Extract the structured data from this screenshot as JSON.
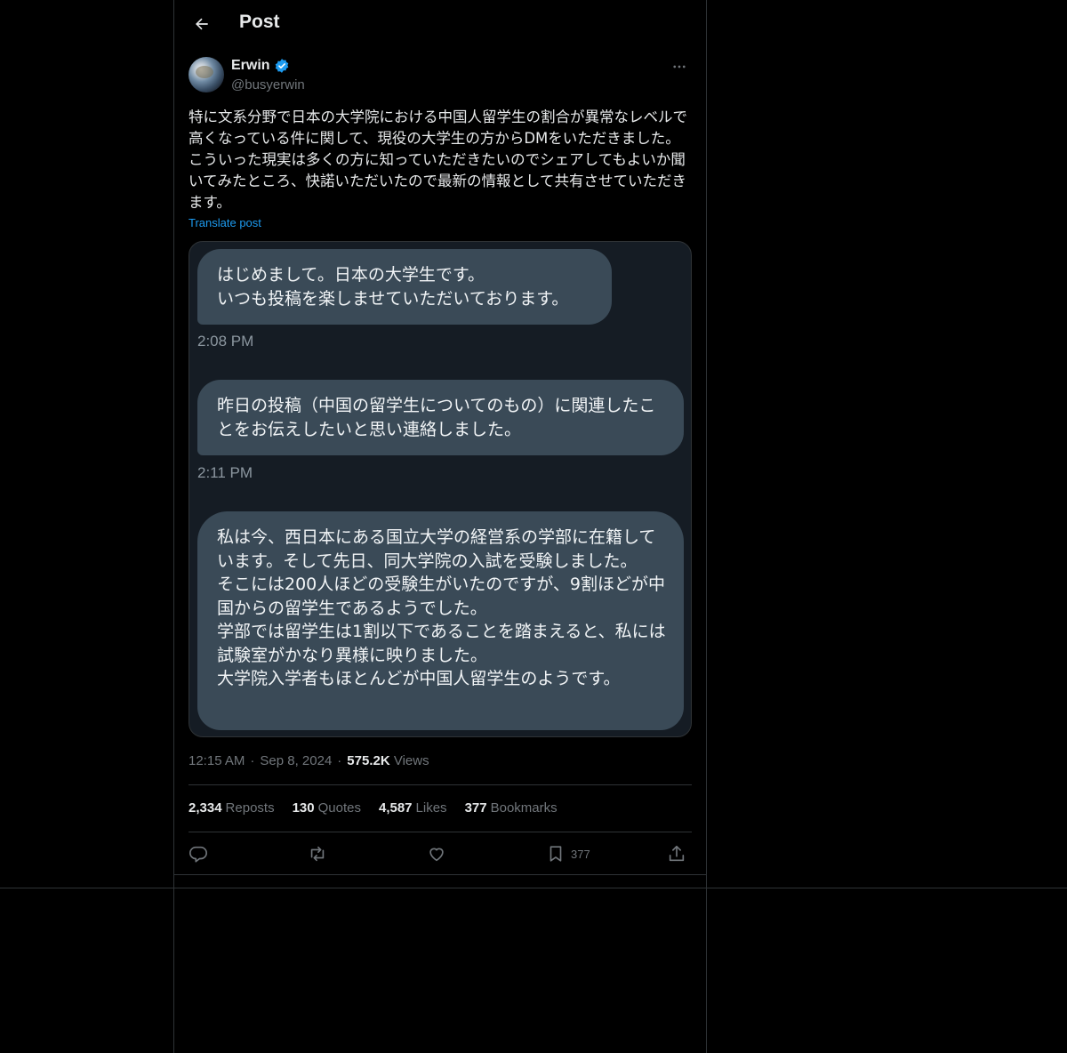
{
  "header": {
    "title": "Post"
  },
  "post": {
    "author_name": "Erwin",
    "author_handle": "@busyerwin",
    "text": "特に文系分野で日本の大学院における中国人留学生の割合が異常なレベルで高くなっている件に関して、現役の大学生の方からDMをいただきました。こういった現実は多くの方に知っていただきたいのでシェアしてもよいか聞いてみたところ、快諾いただいたので最新の情報として共有させていただきます。",
    "translate_label": "Translate post",
    "time": "12:15 AM",
    "date": "Sep 8, 2024",
    "views_count": "575.2K",
    "views_label": "Views"
  },
  "media": {
    "messages": [
      {
        "text": "はじめまして。日本の大学生です。\nいつも投稿を楽しませていただいております。",
        "time": "2:08 PM"
      },
      {
        "text": "昨日の投稿（中国の留学生についてのもの）に関連したことをお伝えしたいと思い連絡しました。",
        "time": "2:11 PM"
      },
      {
        "text": "私は今、西日本にある国立大学の経営系の学部に在籍しています。そして先日、同大学院の入試を受験しました。\nそこには200人ほどの受験生がいたのですが、9割ほどが中国からの留学生であるようでした。\n学部では留学生は1割以下であることを踏まえると、私には試験室がかなり異様に映りました。\n大学院入学者もほとんどが中国人留学生のようです。"
      }
    ]
  },
  "stats": {
    "reposts_count": "2,334",
    "reposts_label": "Reposts",
    "quotes_count": "130",
    "quotes_label": "Quotes",
    "likes_count": "4,587",
    "likes_label": "Likes",
    "bookmarks_count": "377",
    "bookmarks_label": "Bookmarks"
  },
  "actions": {
    "bookmark_count": "377"
  },
  "icons": {
    "back": "arrow-left-icon",
    "verified": "verified-badge-icon",
    "more": "more-horizontal-icon",
    "reply": "reply-icon",
    "repost": "repost-icon",
    "like": "heart-icon",
    "bookmark": "bookmark-icon",
    "share": "share-icon"
  },
  "colors": {
    "background": "#000000",
    "accent": "#1d9bf0",
    "bubble": "#3a4a57",
    "muted": "#71767b"
  }
}
